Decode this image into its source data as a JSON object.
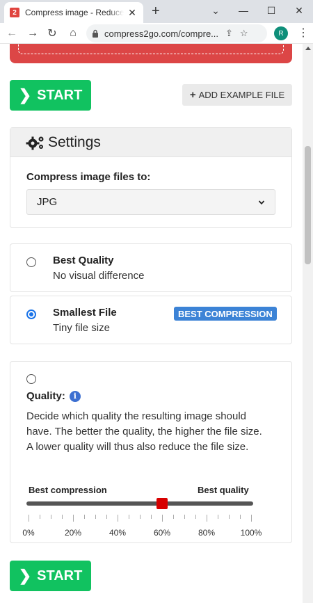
{
  "browser": {
    "tab_title": "Compress image - Reduce image",
    "favicon_text": "2",
    "url": "compress2go.com/compre...",
    "avatar_initial": "R"
  },
  "page": {
    "start_label": "START",
    "add_example_label": "ADD EXAMPLE FILE",
    "settings": {
      "title": "Settings",
      "compress_label": "Compress image files to:",
      "format_value": "JPG"
    },
    "options": [
      {
        "title": "Best Quality",
        "desc": "No visual difference",
        "selected": false
      },
      {
        "title": "Smallest File",
        "desc": "Tiny file size",
        "selected": true,
        "badge": "BEST COMPRESSION"
      }
    ],
    "quality": {
      "label": "Quality:",
      "description": "Decide which quality the resulting image should have. The better the quality, the higher the file size. A lower quality will thus also reduce the file size.",
      "left_label": "Best compression",
      "right_label": "Best quality",
      "value_percent": 60,
      "tick_labels": [
        "0%",
        "20%",
        "40%",
        "60%",
        "80%",
        "100%"
      ],
      "selected": false
    }
  },
  "colors": {
    "accent_green": "#11c260",
    "danger_red": "#dc4646",
    "badge_blue": "#3c83d6",
    "slider_handle": "#d70000"
  }
}
